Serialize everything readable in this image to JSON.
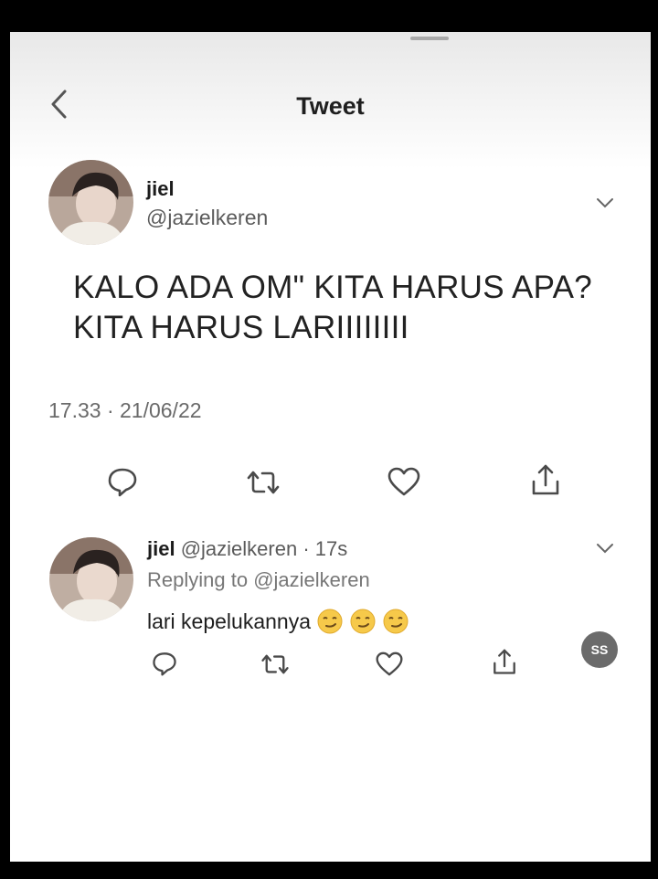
{
  "header": {
    "title": "Tweet"
  },
  "tweet": {
    "name": "jiel",
    "handle": "@jazielkeren",
    "text": "KALO ADA OM\" KITA HARUS APA? KITA HARUS LARIIIIIIII",
    "timestamp": "17.33 · 21/06/22"
  },
  "reply": {
    "name": "jiel",
    "handle_time": "@jazielkeren · 17s",
    "replying_prefix": "Replying to ",
    "replying_handle": "@jazielkeren",
    "text": "lari kepelukannya"
  },
  "watermark": {
    "text": "SS"
  },
  "colors": {
    "icon": "#4a4a4a",
    "text": "#1a1a1a",
    "muted": "#6a6a6a"
  }
}
